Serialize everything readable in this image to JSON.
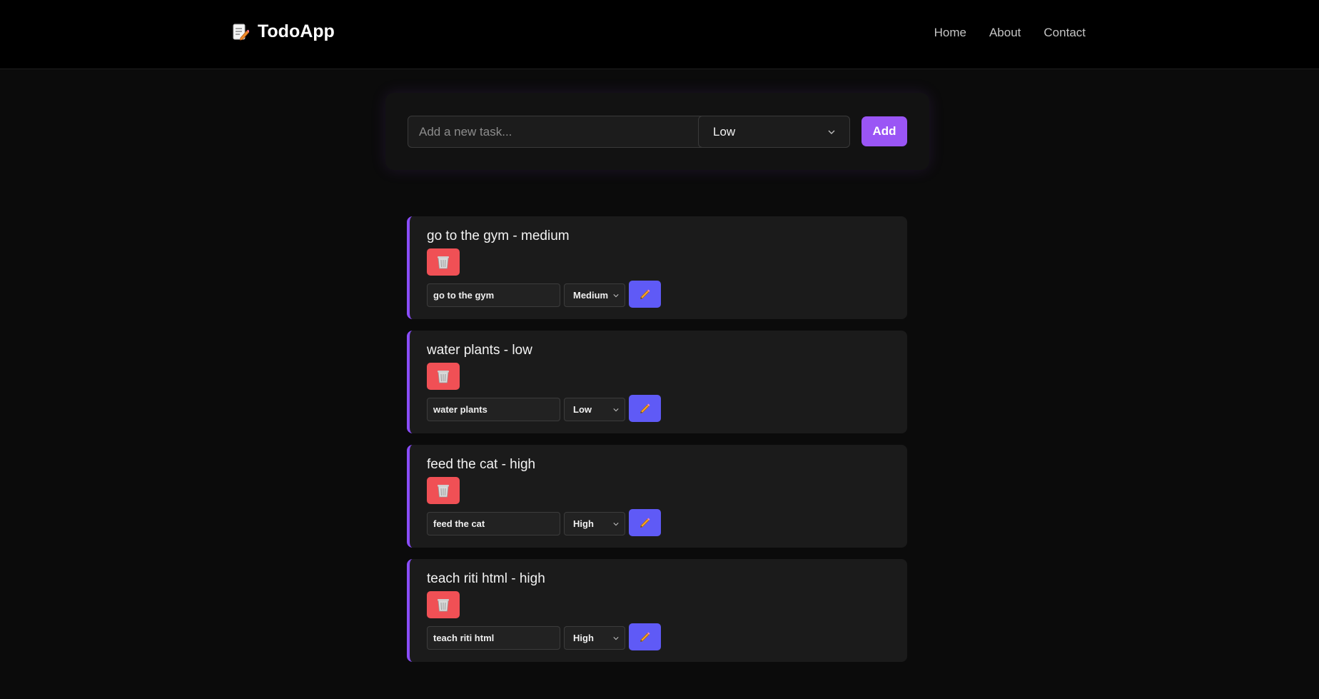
{
  "header": {
    "brand_icon": "memo-icon",
    "brand_title": "TodoApp",
    "nav": [
      {
        "label": "Home"
      },
      {
        "label": "About"
      },
      {
        "label": "Contact"
      }
    ]
  },
  "new_task": {
    "placeholder": "Add a new task...",
    "value": "",
    "priority_selected": "Low",
    "add_label": "Add",
    "accent_color": "#9a55f5"
  },
  "todos": [
    {
      "title": "go to the gym - medium",
      "edit_value": "go to the gym",
      "priority": "Medium"
    },
    {
      "title": "water plants - low",
      "edit_value": "water plants",
      "priority": "Low"
    },
    {
      "title": "feed the cat - high",
      "edit_value": "feed the cat",
      "priority": "High"
    },
    {
      "title": "teach riti html - high",
      "edit_value": "teach riti html",
      "priority": "High"
    }
  ],
  "icons": {
    "delete": "trash-icon",
    "edit": "pencil-icon"
  },
  "colors": {
    "delete_button": "#f05055",
    "edit_button": "#5f5af6",
    "card_accent": "#8a4dff"
  }
}
